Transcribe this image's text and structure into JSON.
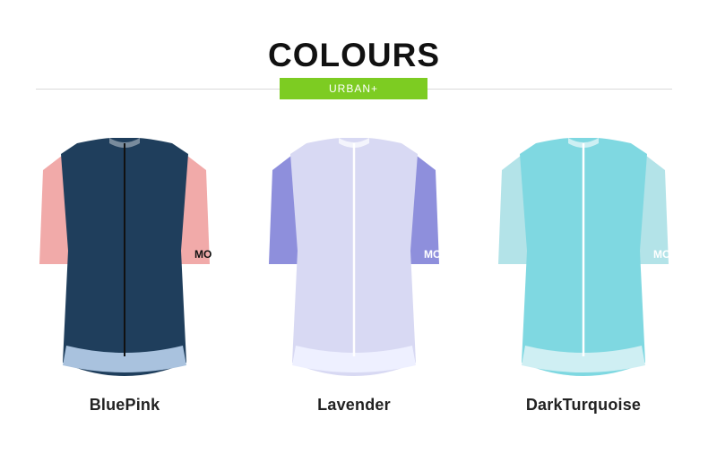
{
  "header": {
    "title": "COLOURS",
    "tag": "URBAN+"
  },
  "products": [
    {
      "name": "BluePink",
      "body_color": "#1f3e5c",
      "sleeve_color": "#f1aaa9",
      "hem_color": "#a9c2de",
      "zip_color": "#111111",
      "sleeve_text": "MO"
    },
    {
      "name": "Lavender",
      "body_color": "#d8d9f3",
      "sleeve_color": "#8e8fdc",
      "hem_color": "#eef0ff",
      "zip_color": "#ffffff",
      "sleeve_text": "MO"
    },
    {
      "name": "DarkTurquoise",
      "body_color": "#7fd8e1",
      "sleeve_color": "#b3e3e8",
      "hem_color": "#cfeff3",
      "zip_color": "#ffffff",
      "sleeve_text": "MO"
    }
  ]
}
